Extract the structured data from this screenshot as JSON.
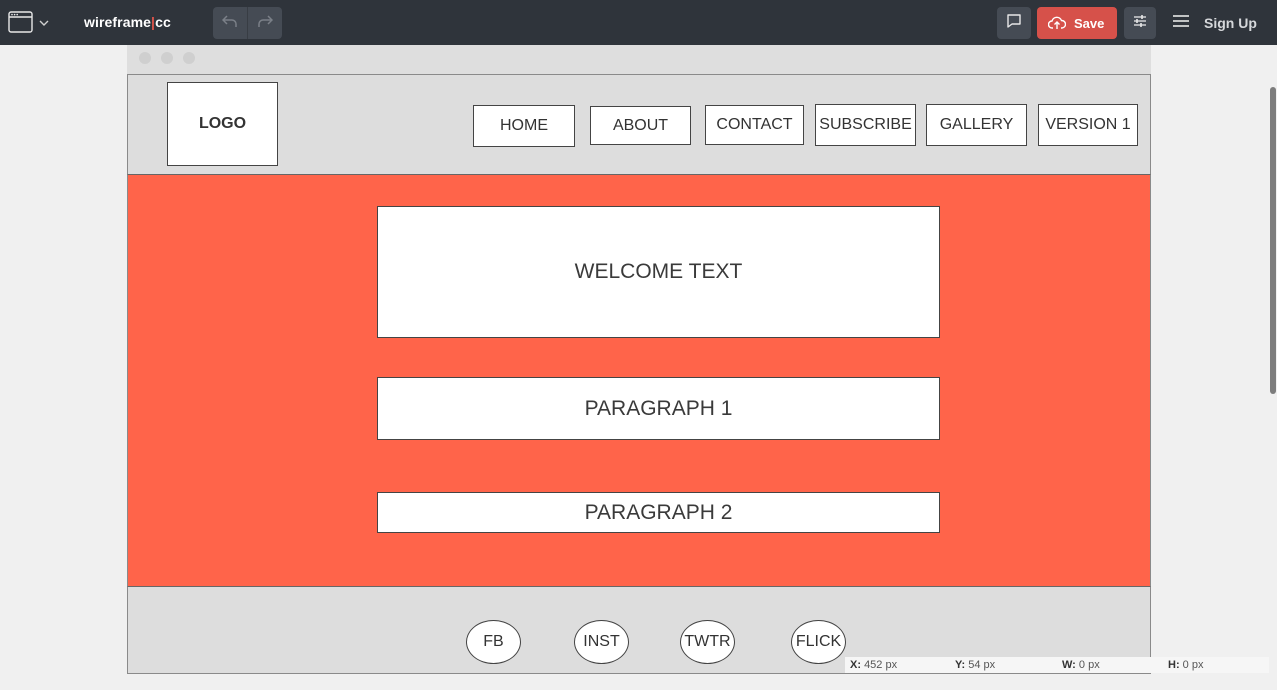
{
  "toolbar": {
    "brand_left": "wireframe",
    "brand_sep": "|",
    "brand_right": "cc",
    "save_label": "Save",
    "signup_label": "Sign Up",
    "icons": [
      "window-icon",
      "chevron-down-icon",
      "undo-icon",
      "redo-icon",
      "comment-icon",
      "cloud-upload-icon",
      "settings-sliders-icon",
      "hamburger-menu-icon"
    ]
  },
  "wireframe": {
    "logo": "LOGO",
    "nav": [
      "HOME",
      "ABOUT",
      "CONTACT",
      "SUBSCRIBE",
      "GALLERY",
      "VERSION 1"
    ],
    "welcome": "WELCOME TEXT",
    "paragraph1": "PARAGRAPH 1",
    "paragraph2": "PARAGRAPH 2",
    "social": [
      "FB",
      "INST",
      "TWTR",
      "FLICK"
    ]
  },
  "status": {
    "x_label": "X:",
    "x_value": "452 px",
    "y_label": "Y:",
    "y_value": "54 px",
    "w_label": "W:",
    "w_value": "0 px",
    "h_label": "H:",
    "h_value": "0 px"
  },
  "colors": {
    "toolbar_bg": "#2f343b",
    "save_bg": "#d6514a",
    "brand_sep": "#e0544a",
    "hero_bg": "#ff644a",
    "header_bg": "#dddddd"
  }
}
